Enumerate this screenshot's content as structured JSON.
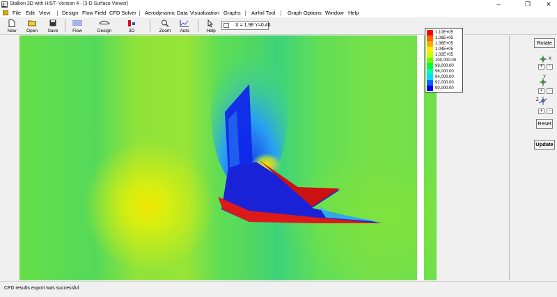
{
  "window": {
    "title": "Stallion 3D with HIST- Version 4 - [3-D Surface Viewer]"
  },
  "menu": {
    "items": [
      "File",
      "Edit",
      "View",
      "Design",
      "Flow Field",
      "CFD Solver",
      "Aerodynamic Data",
      "Visualization",
      "Graphs",
      "Airfoil Tool",
      "Graph Options",
      "Window",
      "Help"
    ]
  },
  "toolbar": {
    "new_label": "New",
    "open_label": "Open",
    "save_label": "Save",
    "flow_label": "Flow",
    "design_label": "Design",
    "3d_label": "3D",
    "zoom_label": "Zoom",
    "auto_label": "Auto",
    "help_label": "Help",
    "coord_readout": "X = 1.98  Y=0.46"
  },
  "side_panel": {
    "rotate_label": "Rotate",
    "x_axis": "X",
    "y_axis": "Y",
    "z_axis": "Z",
    "plus": "+",
    "minus": "-",
    "reset_label": "Reset",
    "update_label": "Update"
  },
  "legend": {
    "entries": [
      {
        "label": "1.10E+05",
        "color": "#ff0000"
      },
      {
        "label": "1.08E+05",
        "color": "#ff6600"
      },
      {
        "label": "1.06E+05",
        "color": "#ffaa00"
      },
      {
        "label": "1.04E+05",
        "color": "#ffee00"
      },
      {
        "label": "1.02E+05",
        "color": "#ccff00"
      },
      {
        "label": "100,000.00",
        "color": "#66ff00"
      },
      {
        "label": "98,000.00",
        "color": "#00ff33"
      },
      {
        "label": "96,000.00",
        "color": "#00ffaa"
      },
      {
        "label": "94,000.00",
        "color": "#00ddff"
      },
      {
        "label": "92,000.00",
        "color": "#0066ff"
      },
      {
        "label": "90,000.00",
        "color": "#0000ee"
      }
    ]
  },
  "status": {
    "message": "CFD results export was successful"
  },
  "colors": {
    "accent_red": "#cc1111",
    "panel_bg": "#f0f0f0"
  }
}
